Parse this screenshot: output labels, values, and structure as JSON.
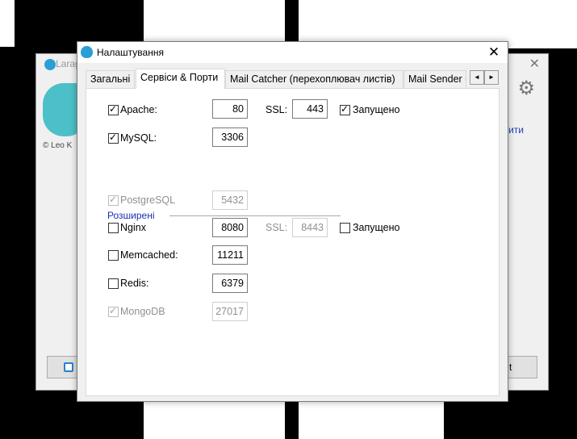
{
  "background_window": {
    "title": "Larag",
    "credit": "© Leo K",
    "link_text": "тити",
    "button_right": "t"
  },
  "dialog": {
    "title": "Налаштування",
    "tabs": [
      "Загальні",
      "Сервіси & Порти",
      "Mail Catcher (перехоплювач листів)",
      "Mail Sender ("
    ],
    "active_tab": 1,
    "scroll_left": "◄",
    "scroll_right": "►"
  },
  "services": {
    "apache": {
      "label": "Apache:",
      "checked": true,
      "port": "80",
      "ssl_label": "SSL:",
      "ssl_port": "443",
      "running_label": "Запущено",
      "running": true
    },
    "mysql": {
      "label": "MySQL:",
      "checked": true,
      "port": "3306"
    },
    "advanced_label": "Розширені",
    "postgresql": {
      "label": "PostgreSQL",
      "checked": true,
      "disabled": true,
      "port": "5432"
    },
    "nginx": {
      "label": "Nginx",
      "checked": false,
      "port": "8080",
      "ssl_label": "SSL:",
      "ssl_port": "8443",
      "running_label": "Запущено",
      "running": false
    },
    "memcached": {
      "label": "Memcached:",
      "checked": false,
      "port": "11211"
    },
    "redis": {
      "label": "Redis:",
      "checked": false,
      "port": "6379"
    },
    "mongodb": {
      "label": "MongoDB",
      "checked": true,
      "disabled": true,
      "port": "27017"
    }
  }
}
